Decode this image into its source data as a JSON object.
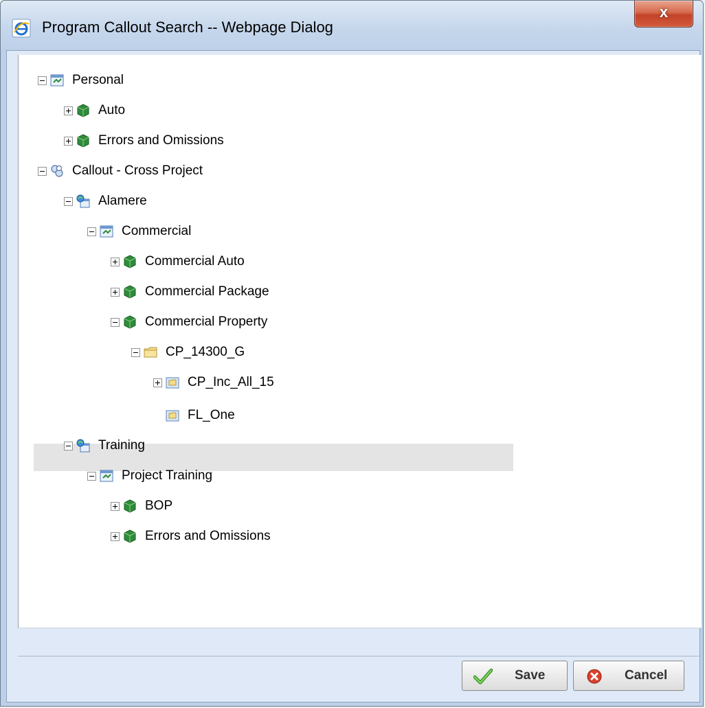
{
  "window": {
    "title": "Program Callout Search -- Webpage Dialog",
    "close_label": "x"
  },
  "tree": [
    {
      "label": "Personal",
      "toggle": "minus",
      "icon": "program-icon"
    },
    {
      "label": "Auto",
      "toggle": "plus",
      "icon": "product-cube-icon"
    },
    {
      "label": "Errors and Omissions",
      "toggle": "plus",
      "icon": "product-cube-icon"
    },
    {
      "label": "Callout - Cross Project",
      "toggle": "minus",
      "icon": "cross-project-icon"
    },
    {
      "label": "Alamere",
      "toggle": "minus",
      "icon": "company-icon"
    },
    {
      "label": "Commercial",
      "toggle": "minus",
      "icon": "program-icon"
    },
    {
      "label": "Commercial Auto",
      "toggle": "plus",
      "icon": "product-cube-icon"
    },
    {
      "label": "Commercial Package",
      "toggle": "plus",
      "icon": "product-cube-icon"
    },
    {
      "label": "Commercial Property",
      "toggle": "minus",
      "icon": "product-cube-icon"
    },
    {
      "label": "CP_14300_G",
      "toggle": "minus",
      "icon": "folder-icon"
    },
    {
      "label": "CP_Inc_All_15",
      "toggle": "plus",
      "icon": "version-folder-icon"
    },
    {
      "label": "FL_One",
      "toggle": "none",
      "icon": "version-folder-icon",
      "selected": true
    },
    {
      "label": "Training",
      "toggle": "minus",
      "icon": "company-icon"
    },
    {
      "label": "Project Training",
      "toggle": "minus",
      "icon": "program-icon"
    },
    {
      "label": "BOP",
      "toggle": "plus",
      "icon": "product-cube-icon"
    },
    {
      "label": "Errors and Omissions",
      "toggle": "plus",
      "icon": "product-cube-icon"
    }
  ],
  "buttons": {
    "save": {
      "label": "Save",
      "icon": "checkmark-icon"
    },
    "cancel": {
      "label": "Cancel",
      "icon": "cancel-x-icon"
    }
  },
  "colors": {
    "selected_row": "#e4e4e4",
    "footer": "#dfe9f7",
    "cube": "#2e8b3a"
  }
}
